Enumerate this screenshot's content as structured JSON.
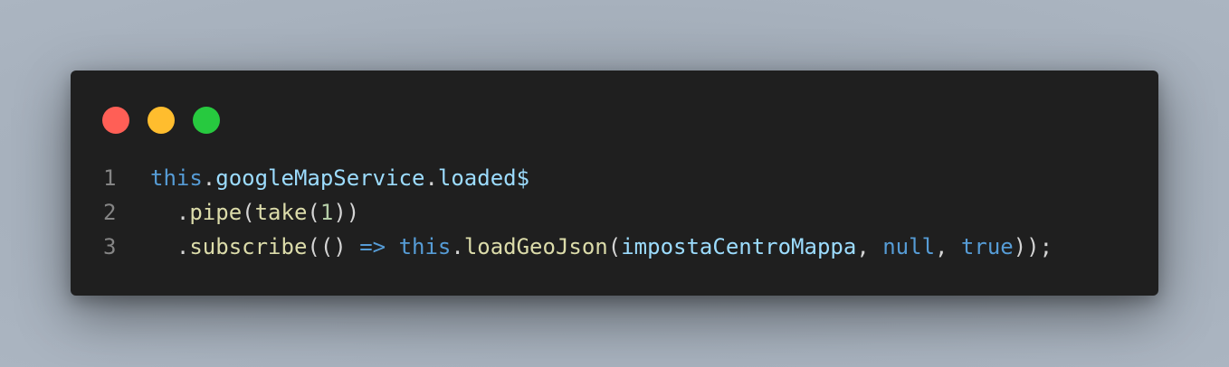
{
  "colors": {
    "background": "#a8b3bf",
    "editor_background": "#1f1f1f",
    "dot_close": "#ff5f56",
    "dot_minimize": "#ffbd2e",
    "dot_maximize": "#27c93f",
    "line_number": "#858585",
    "keyword": "#569cd6",
    "property": "#9cdcfe",
    "function": "#dcdcaa",
    "number": "#b5cea8",
    "punctuation": "#d4d4d4"
  },
  "window": {
    "controls": [
      "close-dot",
      "minimize-dot",
      "maximize-dot"
    ]
  },
  "code": {
    "lines": [
      {
        "number": "1",
        "tokens": [
          {
            "t": "this",
            "c": "kw"
          },
          {
            "t": ".",
            "c": "punc"
          },
          {
            "t": "googleMapService",
            "c": "prop"
          },
          {
            "t": ".",
            "c": "punc"
          },
          {
            "t": "loaded$",
            "c": "prop"
          }
        ]
      },
      {
        "number": "2",
        "tokens": [
          {
            "t": "  .",
            "c": "punc"
          },
          {
            "t": "pipe",
            "c": "fn"
          },
          {
            "t": "(",
            "c": "punc"
          },
          {
            "t": "take",
            "c": "fn"
          },
          {
            "t": "(",
            "c": "punc"
          },
          {
            "t": "1",
            "c": "num"
          },
          {
            "t": "))",
            "c": "punc"
          }
        ]
      },
      {
        "number": "3",
        "tokens": [
          {
            "t": "  .",
            "c": "punc"
          },
          {
            "t": "subscribe",
            "c": "fn"
          },
          {
            "t": "(() ",
            "c": "punc"
          },
          {
            "t": "=>",
            "c": "kw"
          },
          {
            "t": " ",
            "c": "punc"
          },
          {
            "t": "this",
            "c": "kw"
          },
          {
            "t": ".",
            "c": "punc"
          },
          {
            "t": "loadGeoJson",
            "c": "fn"
          },
          {
            "t": "(",
            "c": "punc"
          },
          {
            "t": "impostaCentroMappa",
            "c": "prop"
          },
          {
            "t": ", ",
            "c": "punc"
          },
          {
            "t": "null",
            "c": "kw"
          },
          {
            "t": ", ",
            "c": "punc"
          },
          {
            "t": "true",
            "c": "kw"
          },
          {
            "t": "));",
            "c": "punc"
          }
        ]
      }
    ]
  }
}
